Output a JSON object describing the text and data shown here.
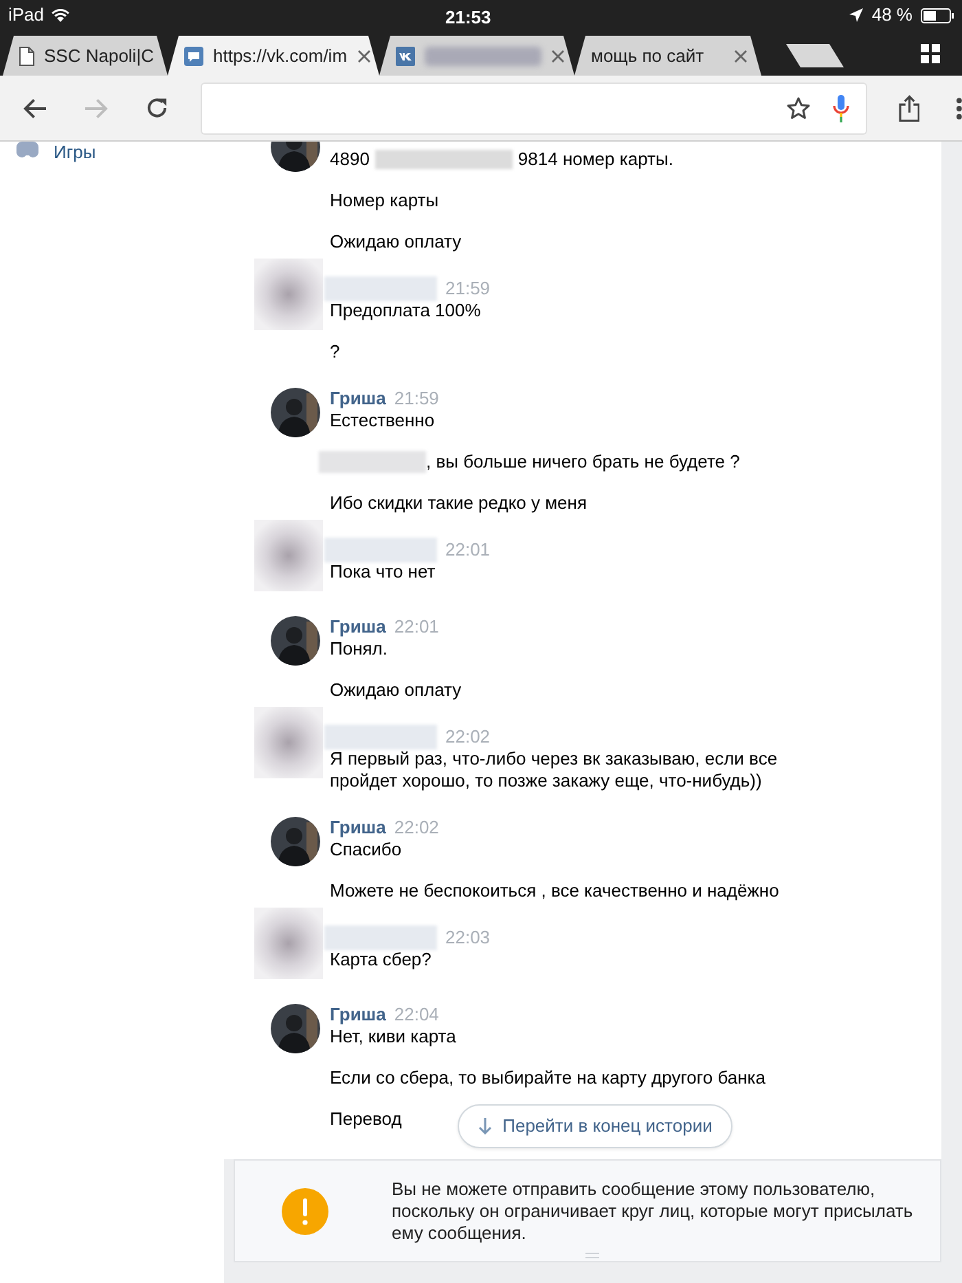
{
  "status_bar": {
    "device": "iPad",
    "time": "21:53",
    "battery": "48 %"
  },
  "tabs": [
    {
      "title": "SSC Napoli|C",
      "selected": false,
      "close_button": false
    },
    {
      "title": "https://vk.com/im",
      "selected": true,
      "close_button": true
    },
    {
      "title_redacted": true,
      "selected": false,
      "close_button": true
    },
    {
      "title": "мощь по сайт",
      "selected": false,
      "close_button": true
    }
  ],
  "toolbar": {
    "forward_disabled": true
  },
  "sidebar": {
    "items": [
      {
        "label": "Игры"
      }
    ]
  },
  "messages": [
    {
      "kind": "named",
      "lines": [
        {
          "parts": [
            "4890",
            "9814 номер карты."
          ]
        },
        {
          "text": "Номер карты"
        },
        {
          "text": "Ожидаю оплату"
        }
      ]
    },
    {
      "kind": "anonymized",
      "time": "21:59",
      "lines": [
        {
          "text": "Предоплата 100%"
        },
        {
          "text": "?"
        }
      ]
    },
    {
      "kind": "named",
      "name": "Гриша",
      "time": "21:59",
      "lines": [
        {
          "text": "Естественно"
        },
        {
          "lead_redacted": true,
          "text": ", вы больше ничего брать не будете ?"
        },
        {
          "text": "Ибо скидки такие редко у меня"
        }
      ]
    },
    {
      "kind": "anonymized",
      "time": "22:01",
      "lines": [
        {
          "text": "Пока что нет"
        }
      ]
    },
    {
      "kind": "named",
      "name": "Гриша",
      "time": "22:01",
      "lines": [
        {
          "text": "Понял."
        },
        {
          "text": "Ожидаю оплату"
        }
      ]
    },
    {
      "kind": "anonymized",
      "time": "22:02",
      "lines": [
        {
          "text": "Я первый раз, что-либо через вк заказываю, если все пройдет хорошо, то позже закажу еще, что-нибудь))"
        }
      ]
    },
    {
      "kind": "named",
      "name": "Гриша",
      "time": "22:02",
      "lines": [
        {
          "text": "Спасибо"
        },
        {
          "text": "Можете не беспокоиться , все качественно и надёжно"
        }
      ]
    },
    {
      "kind": "anonymized",
      "time": "22:03",
      "lines": [
        {
          "text": "Карта сбер?"
        }
      ]
    },
    {
      "kind": "named",
      "name": "Гриша",
      "time": "22:04",
      "lines": [
        {
          "text": "Нет, киви карта"
        },
        {
          "text": "Если со сбера, то выбирайте на карту другого банка"
        },
        {
          "text": "Перевод"
        }
      ]
    }
  ],
  "scroll_button": {
    "label": "Перейти в конец истории"
  },
  "notice": {
    "text": "Вы не можете отправить сообщение этому пользователю, поскольку он ограничивает круг лиц, которые могут присылать ему сообщения."
  }
}
